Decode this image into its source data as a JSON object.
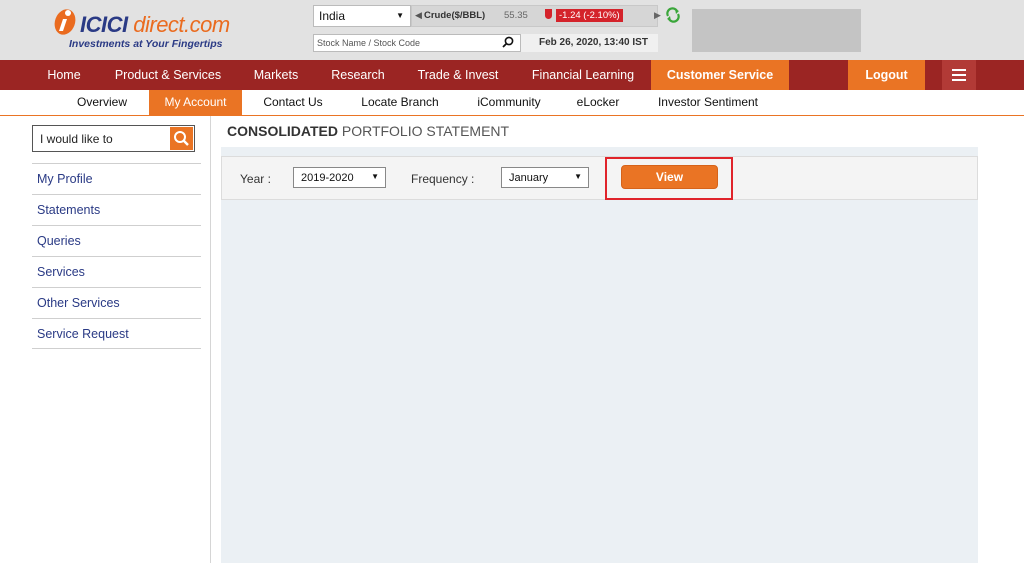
{
  "header": {
    "logo_brand": "ICICI",
    "logo_domain": "direct.com",
    "logo_tagline": "Investments at Your Fingertips",
    "country": "India",
    "ticker_name": "Crude($/BBL)",
    "ticker_price": "55.35",
    "ticker_change": "-1.24 (-2.10%)",
    "search_placeholder": "Stock Name / Stock Code",
    "datetime": "Feb 26, 2020, 13:40 IST"
  },
  "main_nav": [
    "Home",
    "Product & Services",
    "Markets",
    "Research",
    "Trade & Invest",
    "Financial Learning",
    "Customer Service",
    "Logout"
  ],
  "sub_nav": [
    "Overview",
    "My Account",
    "Contact Us",
    "Locate Branch",
    "iCommunity",
    "eLocker",
    "Investor Sentiment"
  ],
  "sidebar": {
    "search_placeholder": "I would like to",
    "items": [
      "My Profile",
      "Statements",
      "Queries",
      "Services",
      "Other Services",
      "Service Request"
    ]
  },
  "content": {
    "title_bold": "CONSOLIDATED",
    "title_rest": " PORTFOLIO STATEMENT",
    "year_label": "Year :",
    "year_value": "2019-2020",
    "frequency_label": "Frequency :",
    "frequency_value": "January",
    "view_label": "View"
  },
  "colors": {
    "brand_maroon": "#9b2523",
    "brand_orange": "#ea7424",
    "brand_navy": "#2a3a85",
    "highlight_red": "#e0242b"
  }
}
